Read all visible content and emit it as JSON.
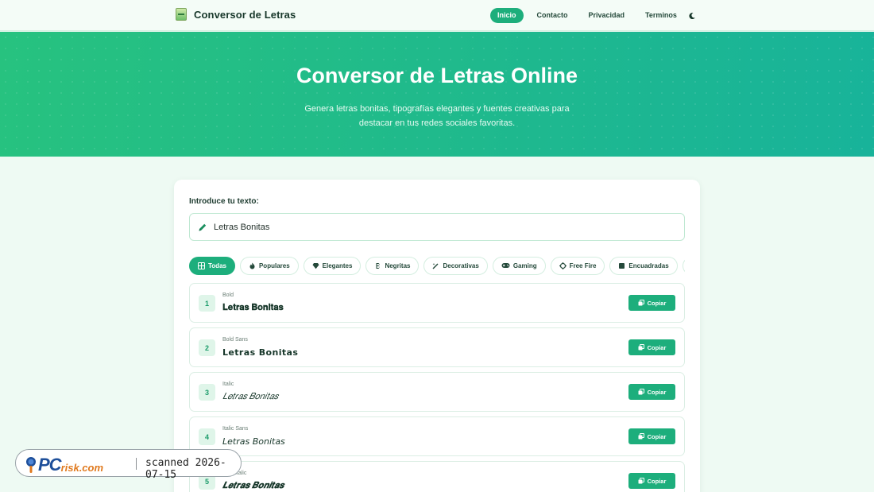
{
  "nav": {
    "brand": "Conversor de Letras",
    "links": [
      "Inicio",
      "Contacto",
      "Privacidad",
      "Terminos"
    ],
    "active": "Inicio",
    "theme_icon": "moon-icon"
  },
  "hero": {
    "title": "Conversor de Letras Online",
    "subtitle": "Genera letras bonitas, tipografías elegantes y fuentes creativas para destacar en tus redes sociales favoritas."
  },
  "input": {
    "label": "Introduce tu texto:",
    "value": "Letras Bonitas",
    "icon": "pencil-icon"
  },
  "filters": [
    {
      "label": "Todas",
      "icon": "grid-icon",
      "active": true
    },
    {
      "label": "Populares",
      "icon": "fire-icon",
      "active": false
    },
    {
      "label": "Elegantes",
      "icon": "gem-icon",
      "active": false
    },
    {
      "label": "Negritas",
      "icon": "bold-icon",
      "active": false
    },
    {
      "label": "Decorativas",
      "icon": "magic-wand-icon",
      "active": false
    },
    {
      "label": "Gaming",
      "icon": "gamepad-icon",
      "active": false
    },
    {
      "label": "Free Fire",
      "icon": "crosshair-icon",
      "active": false
    },
    {
      "label": "Encuadradas",
      "icon": "square-icon",
      "active": false
    },
    {
      "label": "",
      "icon": "heart-icon",
      "active": false
    }
  ],
  "results": [
    {
      "num": "1",
      "name": "Bold",
      "text": "𝐋𝐞𝐭𝐫𝐚𝐬 𝐁𝐨𝐧𝐢𝐭𝐚𝐬",
      "copy": "Copiar"
    },
    {
      "num": "2",
      "name": "Bold Sans",
      "text": "𝗟𝗲𝘁𝗿𝗮𝘀 𝗕𝗼𝗻𝗶𝘁𝗮𝘀",
      "copy": "Copiar"
    },
    {
      "num": "3",
      "name": "Italic",
      "text": "𝐿𝑒𝑡𝑟𝑎𝑠 𝐵𝑜𝑛𝑖𝑡𝑎𝑠",
      "copy": "Copiar"
    },
    {
      "num": "4",
      "name": "Italic Sans",
      "text": "𝘓𝘦𝘵𝘳𝘢𝘴 𝘉𝘰𝘯𝘪𝘵𝘢𝘴",
      "copy": "Copiar"
    },
    {
      "num": "5",
      "name": "Bold Italic",
      "text": "𝑳𝒆𝒕𝒓𝒂𝒔 𝑩𝒐𝒏𝒊𝒕𝒂𝒔",
      "copy": "Copiar"
    }
  ],
  "watermark": {
    "logo_main": "PC",
    "logo_suffix": "risk.com",
    "text": "scanned 2026-07-15"
  },
  "colors": {
    "accent": "#1dae7c",
    "hero_start": "#27c27f",
    "hero_end": "#18b39a",
    "background": "#eefaf3"
  }
}
